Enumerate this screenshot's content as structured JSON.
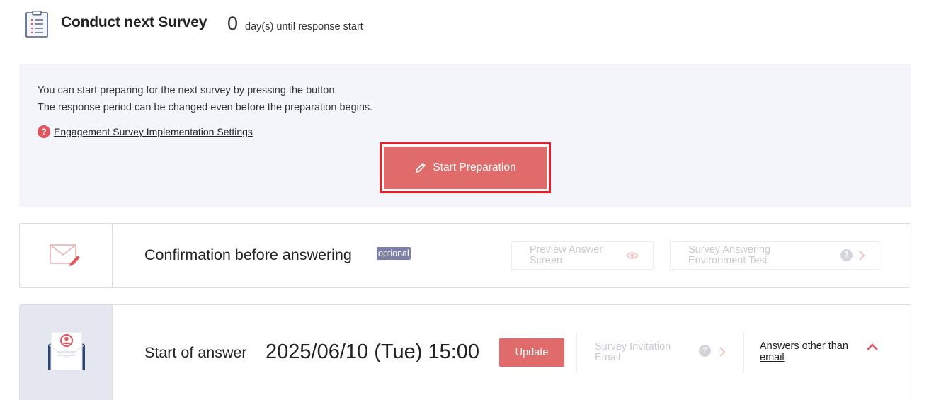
{
  "header": {
    "title": "Conduct next Survey",
    "days_count": "0",
    "days_text": "day(s) until response start",
    "icon": "survey-document-icon"
  },
  "prep_panel": {
    "message_line1": "You can start preparing for the next survey by pressing the button.",
    "message_line2": "The response period can be changed even before the preparation begins.",
    "help_link": "Engagement Survey Implementation Settings",
    "help_icon_glyph": "?",
    "start_button_label": "Start Preparation"
  },
  "confirmation_card": {
    "label": "Confirmation before answering",
    "badge": "optional",
    "preview_button_label": "Preview Answer Screen",
    "environment_test_label": "Survey Answering Environment Test",
    "hint_glyph": "?"
  },
  "answer_card": {
    "label": "Start of answer",
    "datetime": "2025/06/10 (Tue) 15:00",
    "update_button_label": "Update",
    "invitation_email_label": "Survey Invitation Email",
    "hint_glyph": "?",
    "other_answers_link": "Answers other than email"
  },
  "colors": {
    "accent_red": "#e06b6b",
    "highlight_border": "#e5202b",
    "badge": "#7c80a9",
    "panel_bg": "#f4f5fa"
  }
}
